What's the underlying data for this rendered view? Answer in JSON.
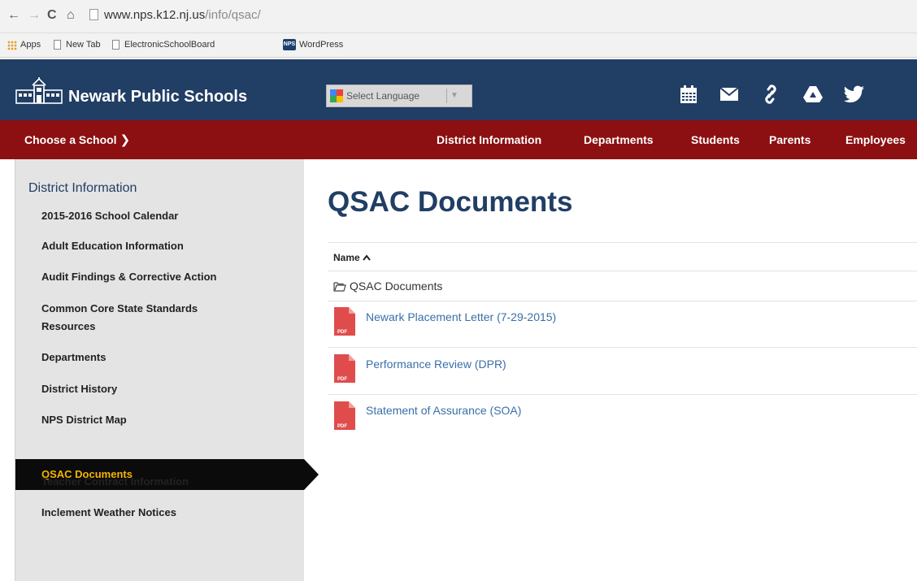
{
  "browser": {
    "url_host": "www.nps.k12.nj.us",
    "url_path": "/info/qsac/",
    "bookmarks": [
      {
        "label": "Apps",
        "icon": "apps-grid-icon"
      },
      {
        "label": "New Tab",
        "icon": "page-icon"
      },
      {
        "label": "ElectronicSchoolBoard",
        "icon": "page-icon"
      },
      {
        "label": "WordPress",
        "icon": "nps-favicon-icon"
      }
    ],
    "nps_badge": "NPS"
  },
  "header": {
    "site_name": "Newark Public Schools",
    "translate_label": "Select Language",
    "translate_arrow": "▼",
    "icons": [
      "calendar-icon",
      "mail-icon",
      "link-icon",
      "drive-icon",
      "twitter-icon"
    ]
  },
  "nav": {
    "choose_school": "Choose a School",
    "choose_chevron": "❯",
    "links": [
      "District Information",
      "Departments",
      "Students",
      "Parents",
      "Employees"
    ]
  },
  "sidebar": {
    "heading": "District Information",
    "items": [
      "2015-2016 School Calendar",
      "Adult Education Information",
      "Audit Findings & Corrective Action",
      "Common Core State Standards Resources",
      "Departments",
      "District History",
      "NPS District Map",
      "QSAC Documents",
      "Teacher Contract Information",
      "Inclement Weather Notices"
    ],
    "active_item": "QSAC Documents"
  },
  "main": {
    "title": "QSAC Documents",
    "column_name": "Name",
    "sort_indicator": "^",
    "folder": "QSAC Documents",
    "documents": [
      {
        "name": "Newark Placement Letter (7-29-2015)",
        "type": "PDF"
      },
      {
        "name": "Performance Review (DPR)",
        "type": "PDF"
      },
      {
        "name": "Statement of Assurance (SOA)",
        "type": "PDF"
      }
    ]
  },
  "colors": {
    "header_blue": "#213e64",
    "nav_red": "#8c1012",
    "sidebar_gray": "#e4e4e4",
    "active_gold": "#f5b400",
    "link_blue": "#3a6fa8",
    "pdf_red": "#e04c4c"
  }
}
